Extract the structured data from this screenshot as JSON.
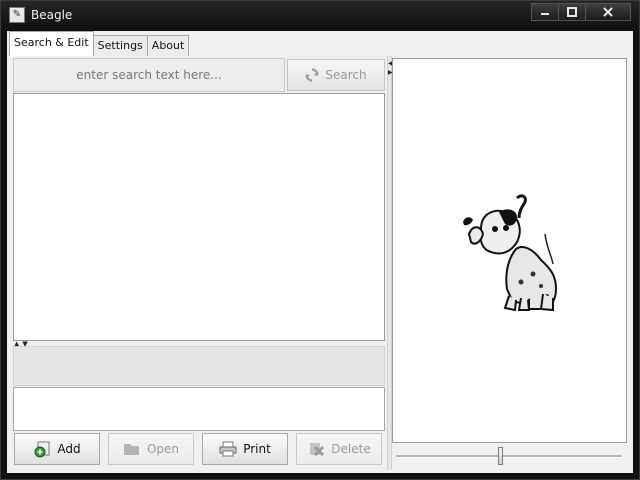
{
  "window": {
    "title": "Beagle",
    "controls": [
      "minimize-icon",
      "maximize-icon",
      "close-icon"
    ]
  },
  "tabs": [
    {
      "label": "Search & Edit",
      "active": true
    },
    {
      "label": "Settings",
      "active": false
    },
    {
      "label": "About",
      "active": false
    }
  ],
  "search": {
    "placeholder": "enter search text here...",
    "button_label": "Search",
    "button_icon": "refresh-icon"
  },
  "actions": {
    "add_label": "Add",
    "open_label": "Open",
    "print_label": "Print",
    "delete_label": "Delete"
  },
  "preview": {
    "image": "beagle-dog-illustration"
  },
  "colors": {
    "window_chrome": "#111111",
    "panel_bg": "#f0f0f0",
    "disabled_text": "#9a9a9a",
    "add_icon_green": "#3a9a3a"
  }
}
